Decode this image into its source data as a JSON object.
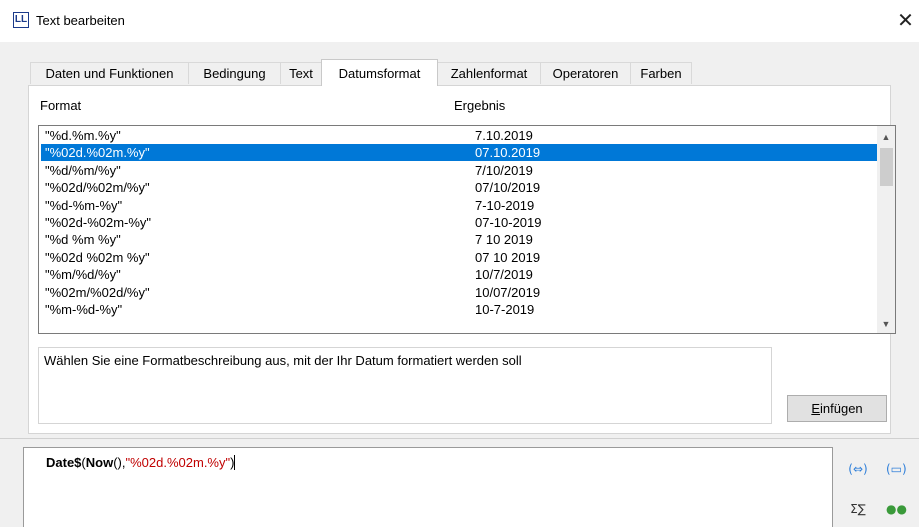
{
  "window": {
    "icon_text": "LL",
    "title": "Text bearbeiten",
    "close_glyph": "✕"
  },
  "tabs": [
    {
      "label": "Daten und Funktionen",
      "active": false
    },
    {
      "label": "Bedingung",
      "active": false
    },
    {
      "label": "Text",
      "active": false
    },
    {
      "label": "Datumsformat",
      "active": true
    },
    {
      "label": "Zahlenformat",
      "active": false
    },
    {
      "label": "Operatoren",
      "active": false
    },
    {
      "label": "Farben",
      "active": false
    }
  ],
  "list": {
    "header_format": "Format",
    "header_result": "Ergebnis",
    "selected_index": 1,
    "rows": [
      {
        "format": "\"%d.%m.%y\"",
        "result": "7.10.2019"
      },
      {
        "format": "\"%02d.%02m.%y\"",
        "result": "07.10.2019"
      },
      {
        "format": "\"%d/%m/%y\"",
        "result": "7/10/2019"
      },
      {
        "format": "\"%02d/%02m/%y\"",
        "result": "07/10/2019"
      },
      {
        "format": "\"%d-%m-%y\"",
        "result": "7-10-2019"
      },
      {
        "format": "\"%02d-%02m-%y\"",
        "result": "07-10-2019"
      },
      {
        "format": "\"%d %m %y\"",
        "result": "7 10 2019"
      },
      {
        "format": "\"%02d %02m %y\"",
        "result": "07 10 2019"
      },
      {
        "format": "\"%m/%d/%y\"",
        "result": "10/7/2019"
      },
      {
        "format": "\"%02m/%02d/%y\"",
        "result": "10/07/2019"
      },
      {
        "format": "\"%m-%d-%y\"",
        "result": "10-7-2019"
      }
    ]
  },
  "description": "Wählen Sie eine Formatbeschreibung aus, mit der Ihr Datum formatiert werden soll",
  "insert_button": {
    "accel": "E",
    "rest": "infügen"
  },
  "editor": {
    "fn1": "Date$",
    "open1": "(",
    "fn2": "Now",
    "mid": "(),",
    "arg": "\"%02d.%02m.%y\"",
    "close1": ")"
  },
  "tools": {
    "tool1": "(⇔)",
    "tool2": "(▭)",
    "tool3": "Σ∑",
    "tool4": "●●"
  },
  "colors": {
    "selection": "#0078d7",
    "string_literal": "#c00000",
    "tool_icon": "#2f7fd9"
  }
}
